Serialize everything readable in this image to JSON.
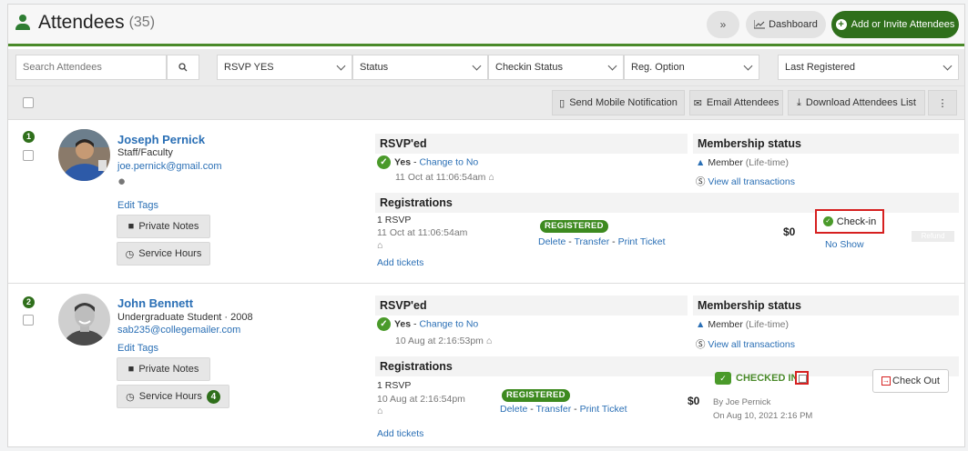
{
  "header": {
    "title": "Attendees",
    "count": "(35)",
    "collapse_icon": "chevrons-down-icon",
    "dashboard_label": "Dashboard",
    "add_label": "Add or Invite Attendees",
    "accent": "#2f6f1b"
  },
  "filters": {
    "search_placeholder": "Search Attendees",
    "rsvp": "RSVP YES",
    "status": "Status",
    "checkin": "Checkin Status",
    "reg_option": "Reg. Option",
    "sort": "Last Registered"
  },
  "actions": {
    "notify": "Send Mobile Notification",
    "email": "Email Attendees",
    "download": "Download Attendees List",
    "more": "⋮"
  },
  "labels": {
    "rsvped": "RSVP'ed",
    "membership": "Membership status",
    "registrations": "Registrations",
    "yes": "Yes",
    "dash": "-",
    "change_to_no": "Change to No",
    "member": "Member",
    "lifetime": "(Life-time)",
    "view_transactions": "View all transactions",
    "edit_tags": "Edit Tags",
    "private_notes": "Private Notes",
    "service_hours": "Service Hours",
    "registered": "REGISTERED",
    "delete": "Delete",
    "transfer": "Transfer",
    "print_ticket": "Print Ticket",
    "add_tickets": "Add tickets",
    "checkin": "Check-in",
    "no_show": "No Show",
    "refund": "Refund",
    "checked_in": "CHECKED IN",
    "check_out": "Check Out"
  },
  "attendees": [
    {
      "index": "1",
      "name": "Joseph Pernick",
      "role": "Staff/Faculty",
      "email": "joe.pernick@gmail.com",
      "device": "apple-icon",
      "rsvp_time": "11 Oct at 11:06:54am",
      "reg_qty": "1 RSVP",
      "reg_time": "11 Oct at 11:06:54am",
      "price": "$0"
    },
    {
      "index": "2",
      "name": "John Bennett",
      "role": "Undergraduate Student · 2008",
      "email": "sab235@collegemailer.com",
      "rsvp_time": "10 Aug at 2:16:53pm",
      "reg_qty": "1 RSVP",
      "reg_time": "10 Aug at 2:16:54pm",
      "price": "$0",
      "service_hours": "4",
      "checked_in_by": "By Joe Pernick",
      "checked_in_on": "On Aug 10, 2021 2:16 PM"
    }
  ]
}
